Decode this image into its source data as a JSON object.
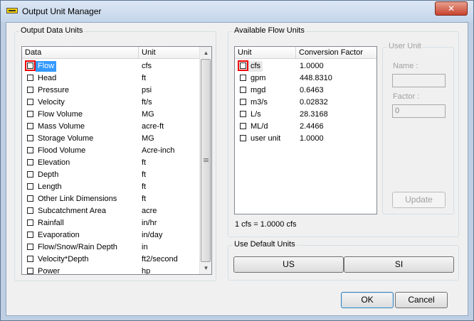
{
  "window": {
    "title": "Output Unit Manager",
    "close_label": "✕"
  },
  "output_data_units": {
    "legend": "Output Data Units",
    "columns": [
      "Data",
      "Unit"
    ],
    "rows": [
      {
        "data": "Flow",
        "unit": "cfs"
      },
      {
        "data": "Head",
        "unit": "ft"
      },
      {
        "data": "Pressure",
        "unit": "psi"
      },
      {
        "data": "Velocity",
        "unit": "ft/s"
      },
      {
        "data": "Flow Volume",
        "unit": "MG"
      },
      {
        "data": "Mass Volume",
        "unit": "acre-ft"
      },
      {
        "data": "Storage Volume",
        "unit": "MG"
      },
      {
        "data": "Flood Volume",
        "unit": "Acre-inch"
      },
      {
        "data": "Elevation",
        "unit": "ft"
      },
      {
        "data": "Depth",
        "unit": "ft"
      },
      {
        "data": "Length",
        "unit": "ft"
      },
      {
        "data": "Other Link Dimensions",
        "unit": "ft"
      },
      {
        "data": "Subcatchment Area",
        "unit": "acre"
      },
      {
        "data": "Rainfall",
        "unit": "in/hr"
      },
      {
        "data": "Evaporation",
        "unit": "in/day"
      },
      {
        "data": "Flow/Snow/Rain Depth",
        "unit": "in"
      },
      {
        "data": "Velocity*Depth",
        "unit": "ft2/second"
      },
      {
        "data": "Power",
        "unit": "hp"
      }
    ]
  },
  "available_flow_units": {
    "legend": "Available Flow Units",
    "columns": [
      "Unit",
      "Conversion Factor"
    ],
    "rows": [
      {
        "unit": "cfs",
        "factor": "1.0000"
      },
      {
        "unit": "gpm",
        "factor": "448.8310"
      },
      {
        "unit": "mgd",
        "factor": "0.6463"
      },
      {
        "unit": "m3/s",
        "factor": "0.02832"
      },
      {
        "unit": "L/s",
        "factor": "28.3168"
      },
      {
        "unit": "ML/d",
        "factor": "2.4466"
      },
      {
        "unit": "user unit",
        "factor": "1.0000"
      }
    ],
    "conversion_text": "1 cfs = 1.0000 cfs"
  },
  "user_unit": {
    "legend": "User Unit",
    "name_label": "Name :",
    "name_value": "",
    "factor_label": "Factor :",
    "factor_value": "0",
    "update_label": "Update"
  },
  "default_units": {
    "legend": "Use Default Units",
    "us_label": "US",
    "si_label": "SI"
  },
  "footer": {
    "ok_label": "OK",
    "cancel_label": "Cancel"
  }
}
